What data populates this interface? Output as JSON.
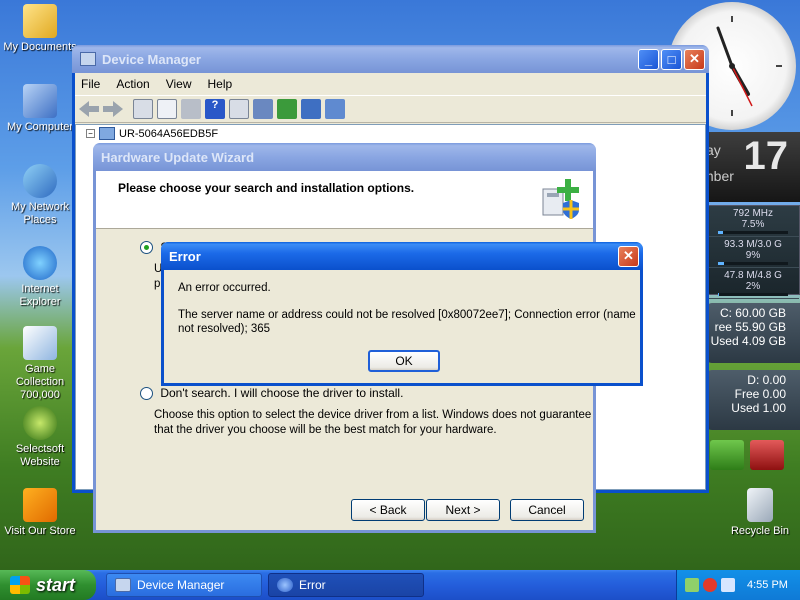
{
  "desktop": {
    "icons": [
      {
        "label": "My Documents",
        "icon": "folder-icon"
      },
      {
        "label": "My Computer",
        "icon": "computer-icon"
      },
      {
        "label": "My Network Places",
        "icon": "network-icon"
      },
      {
        "label": "Internet Explorer",
        "icon": "ie-icon"
      },
      {
        "label": "Game Collection 700,000",
        "icon": "game-icon"
      },
      {
        "label": "Selectsoft Website",
        "icon": "selectsoft-icon"
      },
      {
        "label": "Visit Our Store",
        "icon": "store-icon"
      },
      {
        "label": "Recycle Bin",
        "icon": "recycle-bin-icon"
      }
    ]
  },
  "gadgets": {
    "calendar": {
      "day": "ay",
      "date": "17",
      "month": "mber"
    },
    "cpu": {
      "freq": "792 MHz",
      "cpu_pct": "7.5%",
      "mem1": "93.3 M/3.0 G",
      "mem1_pct": "9%",
      "mem2": "47.8 M/4.8 G",
      "mem2_pct": "2%"
    },
    "drive_c": {
      "line1": "C:  60.00 GB",
      "line2": "ree  55.90 GB",
      "line3": "Used  4.09 GB"
    },
    "drive_d": {
      "line1": "D:  0.00",
      "line2": "Free  0.00",
      "line3": "Used  1.00"
    }
  },
  "device_manager": {
    "title": "Device Manager",
    "menu": [
      "File",
      "Action",
      "View",
      "Help"
    ],
    "tree_root": "UR-5064A56EDB5F"
  },
  "wizard": {
    "title": "Hardware Update Wizard",
    "heading": "Please choose your search and installation options.",
    "option1_partial": "S",
    "option1_desc_partial_a": "U",
    "option1_desc_partial_b": "p",
    "option2_label": "Don't search. I will choose the driver to install.",
    "option2_desc": "Choose this option to select the device driver from a list.  Windows does not guarantee that the driver you choose will be the best match for your hardware.",
    "back_label": "< Back",
    "next_label": "Next >",
    "cancel_label": "Cancel"
  },
  "error_dialog": {
    "title": "Error",
    "message": "An error occurred.",
    "detail": "The server name or address could not be resolved [0x80072ee7]; Connection error (name not resolved); 365",
    "ok_label": "OK"
  },
  "taskbar": {
    "start_label": "start",
    "tasks": [
      {
        "label": "Device Manager"
      },
      {
        "label": "Error"
      }
    ],
    "clock": "4:55 PM"
  },
  "colors": {
    "title_active": "#0a50cc",
    "close_red": "#c7391a",
    "start_green": "#2f8f2f"
  }
}
